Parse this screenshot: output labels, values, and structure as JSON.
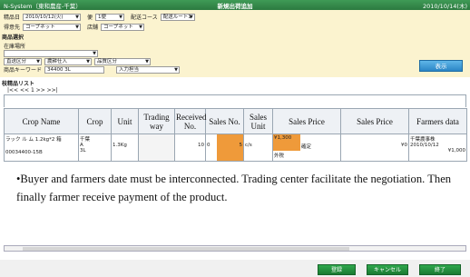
{
  "titlebar": {
    "left": "N-System（東和農産-千葉）",
    "center": "新規出荷追加",
    "right": "2010/10/14(木)"
  },
  "form": {
    "row1": {
      "label1": "精品日",
      "date": "2010/10/12(火)",
      "label2": "便",
      "bin": "1便",
      "label3": "配送コース",
      "course": "配送ルート1"
    },
    "row2": {
      "label1": "得意先",
      "customer": "コープネット",
      "label2": "店舗",
      "store": "コープネット"
    },
    "section1": "商品選択",
    "row3": {
      "label": "在庫場所",
      "value": ""
    },
    "row4": {
      "f1": "直送区分",
      "f2": "農耕仕入",
      "f3": "品質区分"
    },
    "row5": {
      "label": "商品キーワード",
      "value": "34400 3L",
      "f2": "入力担当"
    },
    "section2": "枝精品リスト",
    "pager": "|<< << 1 >> >>|",
    "show_button": "表示"
  },
  "table": {
    "headers": [
      "Crop Name",
      "Crop",
      "Unit",
      "Trading way",
      "Received No.",
      "Sales No.",
      "Sales Unit",
      "Sales Price",
      "Sales Price",
      "Farmers data"
    ],
    "row": {
      "crop_name_top": "ラック ル ム 1.2kg*2 箱",
      "crop_name_bottom": "00034400-15B",
      "crop": "千葉",
      "crop2": "A",
      "crop3": "3L",
      "unit": "1.3Kg",
      "received": "10",
      "sales_no_left": "0",
      "sales_no": "5",
      "sales_unit": "c/s",
      "price_top": "¥1,300",
      "price_mid": "確定",
      "price_bottom": "外税",
      "price2": "¥0",
      "farmer1": "千葉農事株",
      "farmer2": "2010/10/12",
      "farmer3": "¥1,000"
    }
  },
  "note": "•Buyer and farmers date must be interconnected. Trading center facilitate the negotiation. Then finally farmer receive payment of the product.",
  "footer": {
    "b1": "登録",
    "b2": "キャンセル",
    "b3": "終了"
  }
}
